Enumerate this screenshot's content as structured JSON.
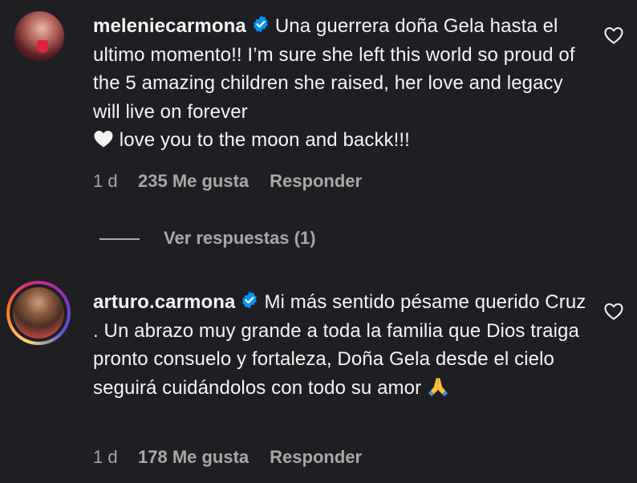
{
  "comments": [
    {
      "username": "meleniecarmona",
      "verified": true,
      "text": "Una guerrera doña Gela hasta el ultimo momento!! I’m sure she left this world so proud of the 5 amazing children she raised, her love and legacy will live on forever",
      "text_after_emoji": " love you to the moon and backk!!!",
      "emoji": "white-heart",
      "time": "1 d",
      "likes": "235 Me gusta",
      "reply_label": "Responder",
      "view_replies": "Ver respuestas (1)"
    },
    {
      "username": "arturo.carmona",
      "verified": true,
      "text": "Mi más sentido pésame querido Cruz . Un abrazo muy grande a toda la familia que Dios traiga pronto consuelo y fortaleza, Doña Gela desde el cielo seguirá cuidándolos con todo su amor ",
      "emoji": "folded-hands",
      "time": "1 d",
      "likes": "178 Me gusta",
      "reply_label": "Responder",
      "story_ring": true
    }
  ],
  "colors": {
    "background": "#1f1f23",
    "text": "#f5f5f5",
    "muted": "#a8a8a8",
    "verified": "#0095f6"
  },
  "icons": {
    "verified": "verified-badge-icon",
    "like": "heart-outline-icon"
  }
}
